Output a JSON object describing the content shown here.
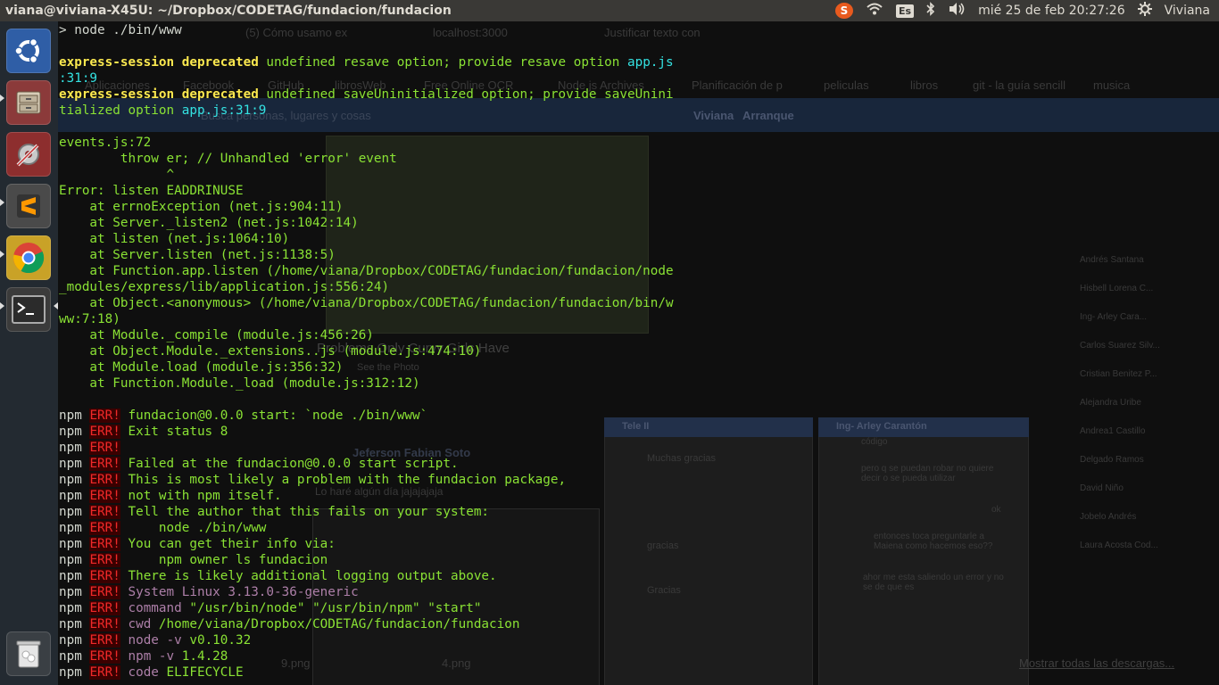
{
  "panel": {
    "title": "viana@viviana-X45U: ~/Dropbox/CODETAG/fundacion/fundacion",
    "keyboard": "Es",
    "clock": "mié 25 de feb 20:27:26",
    "user": "Viviana"
  },
  "launcher": {
    "items": [
      {
        "name": "dash-home",
        "label": "Dash"
      },
      {
        "name": "files",
        "label": "Files"
      },
      {
        "name": "system-settings",
        "label": "System Settings"
      },
      {
        "name": "sublime-text",
        "label": "Sublime Text"
      },
      {
        "name": "chrome",
        "label": "Chrome"
      },
      {
        "name": "terminal",
        "label": "Terminal"
      },
      {
        "name": "trash",
        "label": "Trash"
      }
    ]
  },
  "background": {
    "tabs": [
      "(5) Cómo usamo ex",
      "localhost:3000",
      "Justificar texto con"
    ],
    "bookmarks": [
      "Aplicaciones",
      "Facebook",
      "GitHub",
      "librosWeb",
      "Free Online OCR",
      "Node js Archives",
      "Planificación de p",
      "peliculas",
      "libros",
      "git - la guía sencill",
      "musica"
    ],
    "search_placeholder": "Busca personas, lugares y cosas",
    "fb_nav": [
      "Viviana",
      "Arranque"
    ],
    "post_title": "Problems Only Curvy Girls Have",
    "post_sub": "See the Photo",
    "comment_author": "Jeferson Fabian Soto",
    "comment_text": "Lo haré algún día jajajajaja",
    "chat1_title": "Tele II",
    "chat1_msgs": [
      "Muchas gracias",
      "gracias",
      "Gracias"
    ],
    "chat2_title": "Ing- Arley Carantón",
    "chat2_msgs": [
      "código",
      "pero q se puedan robar no quiere decir o se pueda utilizar",
      "ok",
      "entonces toca preguntarle a Maiena como hacemos eso??",
      "ahor me esta saliendo un error y no se de que es"
    ],
    "sidebar_people": [
      "Andrés Santana",
      "Hisbell Lorena C...",
      "Ing- Arley Cara...",
      "Carlos Suarez Silv...",
      "Cristian Benitez P...",
      "Alejandra Uribe",
      "Andrea1 Castillo",
      "Delgado Ramos",
      "David Niño",
      "Jobelo Andrés",
      "Laura Acosta Cod..."
    ],
    "downloads": [
      "9.png",
      "4.png"
    ],
    "downloads_link": "Mostrar todas las descargas..."
  },
  "terminal": {
    "lines": [
      [
        [
          "w",
          "> node ./bin/www"
        ]
      ],
      [
        [
          "w",
          ""
        ]
      ],
      [
        [
          "y",
          "express-session"
        ],
        [
          "w",
          " "
        ],
        [
          "y",
          "deprecated"
        ],
        [
          "d",
          " undefined resave option; provide resave option "
        ],
        [
          "c",
          "app.js"
        ]
      ],
      [
        [
          "c",
          ":31:9"
        ]
      ],
      [
        [
          "y",
          "express-session"
        ],
        [
          "w",
          " "
        ],
        [
          "y",
          "deprecated"
        ],
        [
          "d",
          " undefined saveUninitialized option; provide saveUnini"
        ]
      ],
      [
        [
          "d",
          "tialized option "
        ],
        [
          "c",
          "app.js:31:9"
        ]
      ],
      [
        [
          "w",
          ""
        ]
      ],
      [
        [
          "d",
          "events.js:72"
        ]
      ],
      [
        [
          "d",
          "        throw er; // Unhandled 'error' event"
        ]
      ],
      [
        [
          "d",
          "              ^"
        ]
      ],
      [
        [
          "d",
          "Error: listen EADDRINUSE"
        ]
      ],
      [
        [
          "d",
          "    at errnoException (net.js:904:11)"
        ]
      ],
      [
        [
          "d",
          "    at Server._listen2 (net.js:1042:14)"
        ]
      ],
      [
        [
          "d",
          "    at listen (net.js:1064:10)"
        ]
      ],
      [
        [
          "d",
          "    at Server.listen (net.js:1138:5)"
        ]
      ],
      [
        [
          "d",
          "    at Function.app.listen (/home/viana/Dropbox/CODETAG/fundacion/fundacion/node"
        ]
      ],
      [
        [
          "d",
          "_modules/express/lib/application.js:556:24)"
        ]
      ],
      [
        [
          "d",
          "    at Object.<anonymous> (/home/viana/Dropbox/CODETAG/fundacion/fundacion/bin/w"
        ]
      ],
      [
        [
          "d",
          "ww:7:18)"
        ]
      ],
      [
        [
          "d",
          "    at Module._compile (module.js:456:26)"
        ]
      ],
      [
        [
          "d",
          "    at Object.Module._extensions..js (module.js:474:10)"
        ]
      ],
      [
        [
          "d",
          "    at Module.load (module.js:356:32)"
        ]
      ],
      [
        [
          "d",
          "    at Function.Module._load (module.js:312:12)"
        ]
      ],
      [
        [
          "w",
          ""
        ]
      ],
      [
        [
          "w",
          "npm "
        ],
        [
          "r",
          "ERR!"
        ],
        [
          "d",
          " fundacion@0.0.0 start: `node ./bin/www`"
        ]
      ],
      [
        [
          "w",
          "npm "
        ],
        [
          "r",
          "ERR!"
        ],
        [
          "d",
          " Exit status 8"
        ]
      ],
      [
        [
          "w",
          "npm "
        ],
        [
          "r",
          "ERR!"
        ]
      ],
      [
        [
          "w",
          "npm "
        ],
        [
          "r",
          "ERR!"
        ],
        [
          "d",
          " Failed at the fundacion@0.0.0 start script."
        ]
      ],
      [
        [
          "w",
          "npm "
        ],
        [
          "r",
          "ERR!"
        ],
        [
          "d",
          " This is most likely a problem with the fundacion package,"
        ]
      ],
      [
        [
          "w",
          "npm "
        ],
        [
          "r",
          "ERR!"
        ],
        [
          "d",
          " not with npm itself."
        ]
      ],
      [
        [
          "w",
          "npm "
        ],
        [
          "r",
          "ERR!"
        ],
        [
          "d",
          " Tell the author that this fails on your system:"
        ]
      ],
      [
        [
          "w",
          "npm "
        ],
        [
          "r",
          "ERR!"
        ],
        [
          "d",
          "     node ./bin/www"
        ]
      ],
      [
        [
          "w",
          "npm "
        ],
        [
          "r",
          "ERR!"
        ],
        [
          "d",
          " You can get their info via:"
        ]
      ],
      [
        [
          "w",
          "npm "
        ],
        [
          "r",
          "ERR!"
        ],
        [
          "d",
          "     npm owner ls fundacion"
        ]
      ],
      [
        [
          "w",
          "npm "
        ],
        [
          "r",
          "ERR!"
        ],
        [
          "d",
          " There is likely additional logging output above."
        ]
      ],
      [
        [
          "w",
          "npm "
        ],
        [
          "r",
          "ERR!"
        ],
        [
          "p",
          " System Linux 3.13.0-36-generic"
        ]
      ],
      [
        [
          "w",
          "npm "
        ],
        [
          "r",
          "ERR!"
        ],
        [
          "p",
          " command"
        ],
        [
          "d",
          " \"/usr/bin/node\" \"/usr/bin/npm\" \"start\""
        ]
      ],
      [
        [
          "w",
          "npm "
        ],
        [
          "r",
          "ERR!"
        ],
        [
          "p",
          " cwd"
        ],
        [
          "d",
          " /home/viana/Dropbox/CODETAG/fundacion/fundacion"
        ]
      ],
      [
        [
          "w",
          "npm "
        ],
        [
          "r",
          "ERR!"
        ],
        [
          "p",
          " node -v"
        ],
        [
          "d",
          " v0.10.32"
        ]
      ],
      [
        [
          "w",
          "npm "
        ],
        [
          "r",
          "ERR!"
        ],
        [
          "p",
          " npm -v"
        ],
        [
          "d",
          " 1.4.28"
        ]
      ],
      [
        [
          "w",
          "npm "
        ],
        [
          "r",
          "ERR!"
        ],
        [
          "p",
          " code"
        ],
        [
          "d",
          " ELIFECYCLE"
        ]
      ]
    ]
  }
}
